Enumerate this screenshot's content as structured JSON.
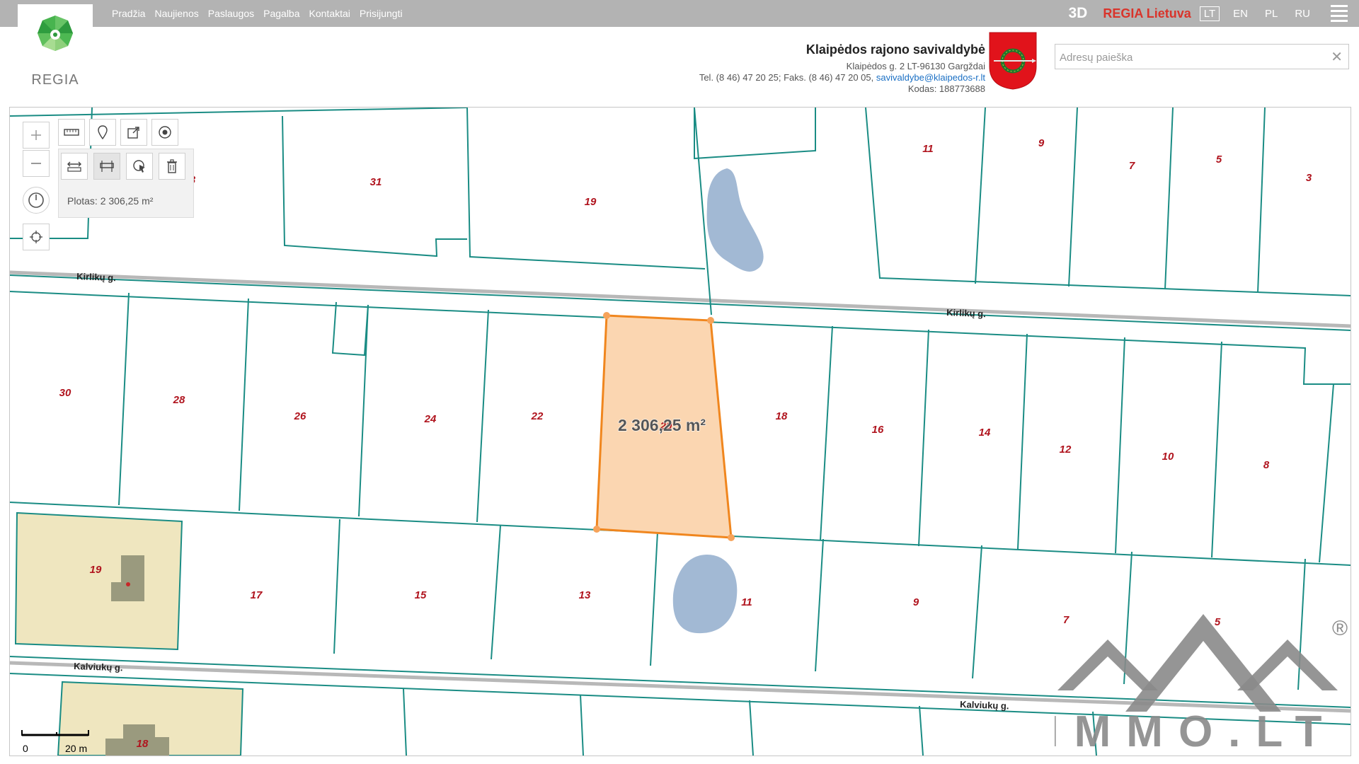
{
  "logo": {
    "text": "REGIA"
  },
  "nav": {
    "items": [
      {
        "label": "Pradžia"
      },
      {
        "label": "Naujienos"
      },
      {
        "label": "Paslaugos"
      },
      {
        "label": "Pagalba"
      },
      {
        "label": "Kontaktai"
      },
      {
        "label": "Prisijungti"
      }
    ]
  },
  "topright": {
    "btn3d": "3D",
    "brand": "REGIA Lietuva",
    "langs": [
      "LT",
      "EN",
      "PL",
      "RU"
    ]
  },
  "municipality": {
    "title": "Klaipėdos rajono savivaldybė",
    "address": "Klaipėdos g. 2 LT-96130 Gargždai",
    "phone": "Tel. (8 46) 47 20 25; Faks. (8 46) 47 20 05,",
    "email": "savivaldybe@klaipedos-r.lt",
    "code": "Kodas: 188773688"
  },
  "search": {
    "placeholder": "Adresų paieška"
  },
  "map": {
    "measure_result": "Plotas: 2 306,25 m²",
    "polygon_label": "2 306,25 m²",
    "streets": {
      "kirliku": "Kirlikų g.",
      "kalviuku": "Kalviukų g."
    },
    "parcel_numbers": {
      "p31": "31",
      "p19top": "19",
      "p11top": "11",
      "p9top": "9",
      "p7top": "7",
      "p5top": "5",
      "p3top": "3",
      "p33": "3",
      "p30": "30",
      "p28": "28",
      "p26": "26",
      "p24": "24",
      "p22": "22",
      "p20": "20",
      "p18": "18",
      "p16": "16",
      "p14": "14",
      "p12": "12",
      "p10": "10",
      "p8": "8",
      "p19low": "19",
      "p17": "17",
      "p15": "15",
      "p13": "13",
      "p11low": "11",
      "p9low": "9",
      "p7low": "7",
      "p5low": "5",
      "p18bot": "18"
    },
    "scale": {
      "zero": "0",
      "label": "20 m"
    }
  },
  "watermark": {
    "text": "IMMO.LT",
    "reg": "®"
  },
  "colors": {
    "topbar": "#b3b3b3",
    "parcel_line": "#1a8c84",
    "selection_fill": "#fbd6b1",
    "selection_stroke": "#f0861e",
    "water": "#a2b9d4",
    "building_area": "#efe6bf",
    "building": "#9a9a7e",
    "parcel_number": "#b0141e",
    "brand": "#d9342b"
  },
  "icons": [
    "zoom-in-icon",
    "zoom-out-icon",
    "measure-ruler-icon",
    "marker-icon",
    "share-icon",
    "target-icon",
    "measure-length-icon",
    "measure-area-icon",
    "select-tool-icon",
    "delete-icon",
    "history-icon",
    "locate-icon",
    "hamburger-icon",
    "close-icon"
  ]
}
